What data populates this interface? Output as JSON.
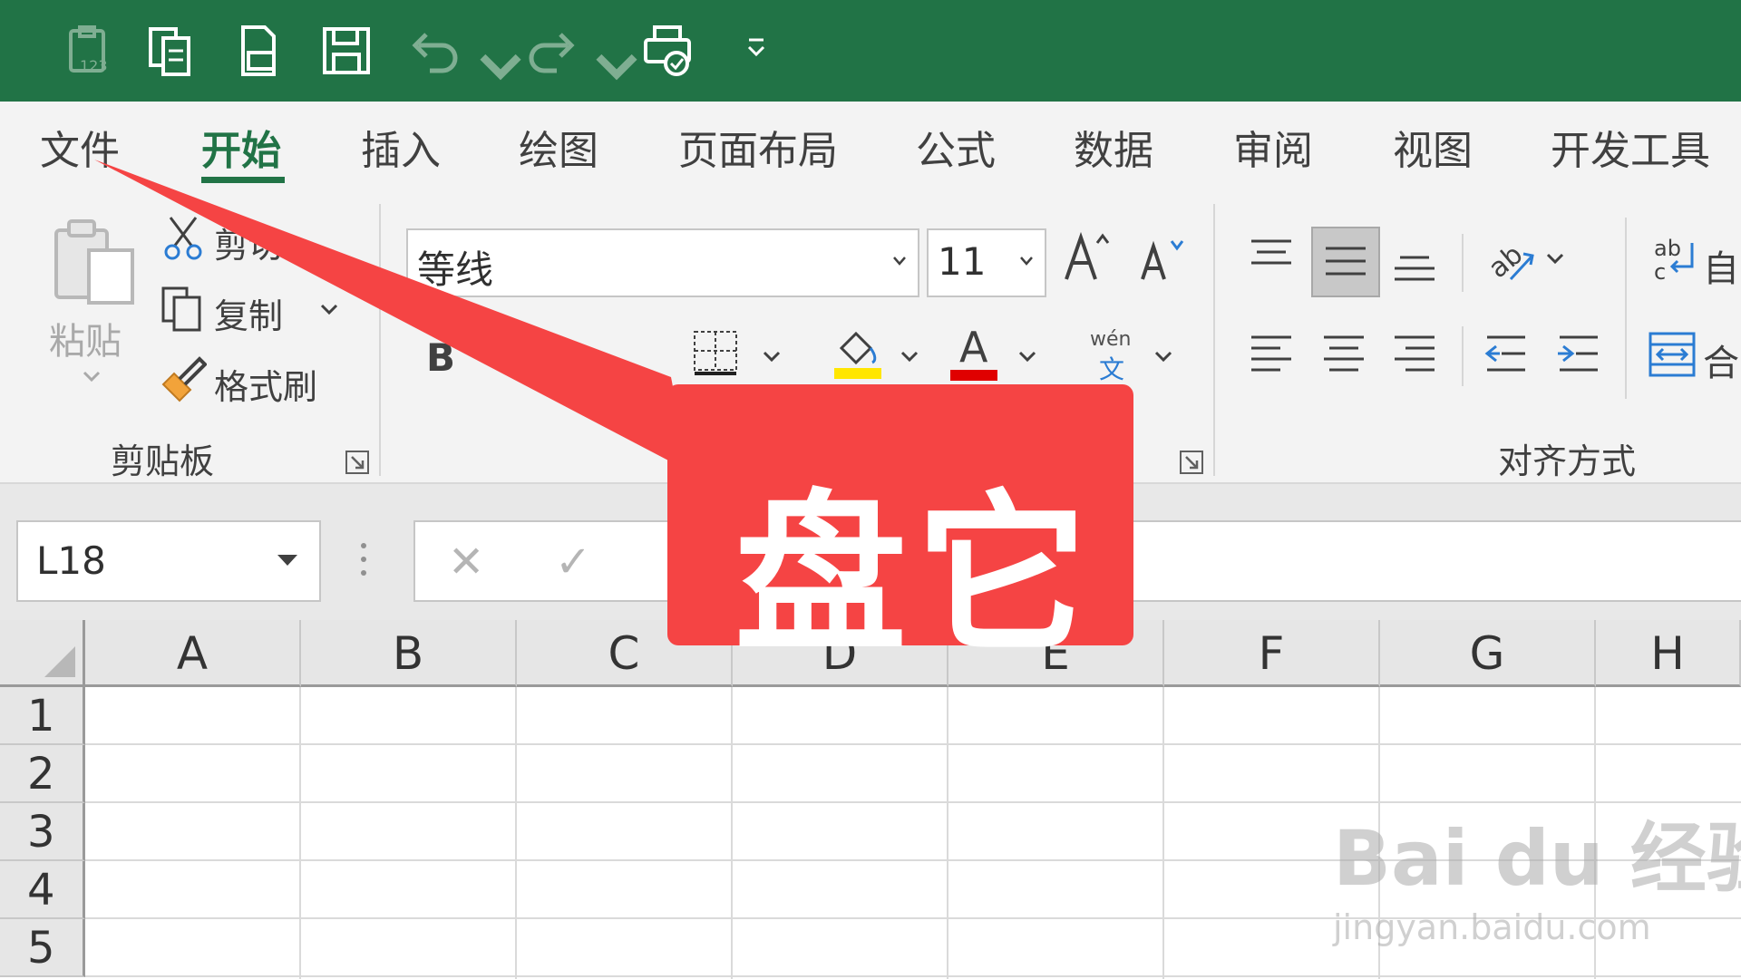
{
  "ribbon_tabs": [
    {
      "label": "文件"
    },
    {
      "label": "开始"
    },
    {
      "label": "插入"
    },
    {
      "label": "绘图"
    },
    {
      "label": "页面布局"
    },
    {
      "label": "公式"
    },
    {
      "label": "数据"
    },
    {
      "label": "审阅"
    },
    {
      "label": "视图"
    },
    {
      "label": "开发工具"
    }
  ],
  "clipboard": {
    "paste": "粘贴",
    "cut": "剪切",
    "copy": "复制",
    "format_painter": "格式刷",
    "group_label": "剪贴板"
  },
  "font": {
    "font_name": "等线",
    "font_size": "11",
    "bold": "B",
    "font_color_letter": "A",
    "phonetic_top": "wén",
    "phonetic_bottom": "文",
    "highlight_color": "#ffe600",
    "font_color": "#e00000"
  },
  "alignment": {
    "wrap_label": "自",
    "merge_label": "合",
    "group_label": "对齐方式"
  },
  "formula_bar": {
    "name_box": "L18",
    "cancel": "✕",
    "enter": "✓"
  },
  "sheet": {
    "columns": [
      "A",
      "B",
      "C",
      "D",
      "E",
      "F",
      "G",
      "H"
    ],
    "rows": [
      "1",
      "2",
      "3",
      "4",
      "5"
    ]
  },
  "callout": {
    "text": "盘它",
    "color": "#f54444"
  },
  "watermark": {
    "line1": "Bai du 经验",
    "line2": "jingyan.baidu.com"
  },
  "theme": {
    "excel_green": "#217346"
  }
}
